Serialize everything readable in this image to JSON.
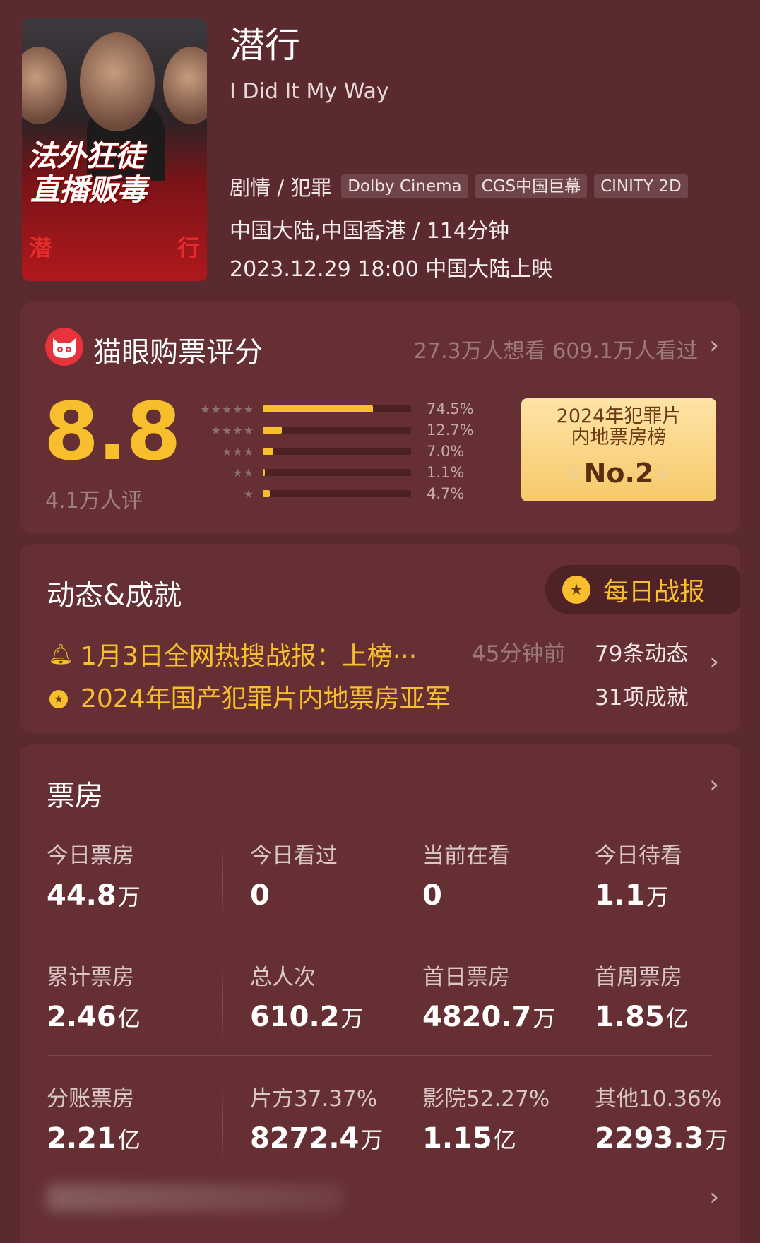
{
  "movie": {
    "title": "潜行",
    "subtitle": "I Did It My Way",
    "genre": "剧情 / 犯罪",
    "tags": [
      "Dolby Cinema",
      "CGS中国巨幕",
      "CINITY 2D"
    ],
    "region_duration": "中国大陆,中国香港 / 114分钟",
    "release": "2023.12.29 18:00 中国大陆上映",
    "poster": {
      "line1": "法外狂徒",
      "line2": "直播贩毒",
      "bottom_left": "潜",
      "bottom_right": "行"
    }
  },
  "rating": {
    "title": "猫眼购票评分",
    "want_watched": "27.3万人想看 609.1万人看过",
    "score": "8.8",
    "count": "4.1万人评",
    "distribution": [
      {
        "stars": 5,
        "percent": 74.5,
        "label": "74.5%"
      },
      {
        "stars": 4,
        "percent": 12.7,
        "label": "12.7%"
      },
      {
        "stars": 3,
        "percent": 7.0,
        "label": "7.0%"
      },
      {
        "stars": 2,
        "percent": 1.1,
        "label": "1.1%"
      },
      {
        "stars": 1,
        "percent": 4.7,
        "label": "4.7%"
      }
    ],
    "rank": {
      "line1": "2024年犯罪片",
      "line2": "内地票房榜",
      "no": "No.2"
    }
  },
  "news": {
    "title": "动态&成就",
    "daily_report": "每日战报",
    "item1": "1月3日全网热搜战报：上榜···",
    "item1_time": "45分钟前",
    "item2": "2024年国产犯罪片内地票房亚军",
    "news_count": "79条动态",
    "achievement_count": "31项成就"
  },
  "box_office": {
    "title": "票房",
    "rows": [
      [
        {
          "label": "今日票房",
          "value": "44.8",
          "unit": "万"
        },
        {
          "label": "今日看过",
          "value": "0",
          "unit": ""
        },
        {
          "label": "当前在看",
          "value": "0",
          "unit": ""
        },
        {
          "label": "今日待看",
          "value": "1.1",
          "unit": "万"
        }
      ],
      [
        {
          "label": "累计票房",
          "value": "2.46",
          "unit": "亿"
        },
        {
          "label": "总人次",
          "value": "610.2",
          "unit": "万"
        },
        {
          "label": "首日票房",
          "value": "4820.7",
          "unit": "万"
        },
        {
          "label": "首周票房",
          "value": "1.85",
          "unit": "亿"
        }
      ],
      [
        {
          "label": "分账票房",
          "value": "2.21",
          "unit": "亿"
        },
        {
          "label": "片方37.37%",
          "value": "8272.4",
          "unit": "万"
        },
        {
          "label": "影院52.27%",
          "value": "1.15",
          "unit": "亿"
        },
        {
          "label": "其他10.36%",
          "value": "2293.3",
          "unit": "万"
        }
      ]
    ]
  },
  "colors": {
    "background": "#5a2a2e",
    "card": "#652f33",
    "accent": "#f7be2e"
  }
}
